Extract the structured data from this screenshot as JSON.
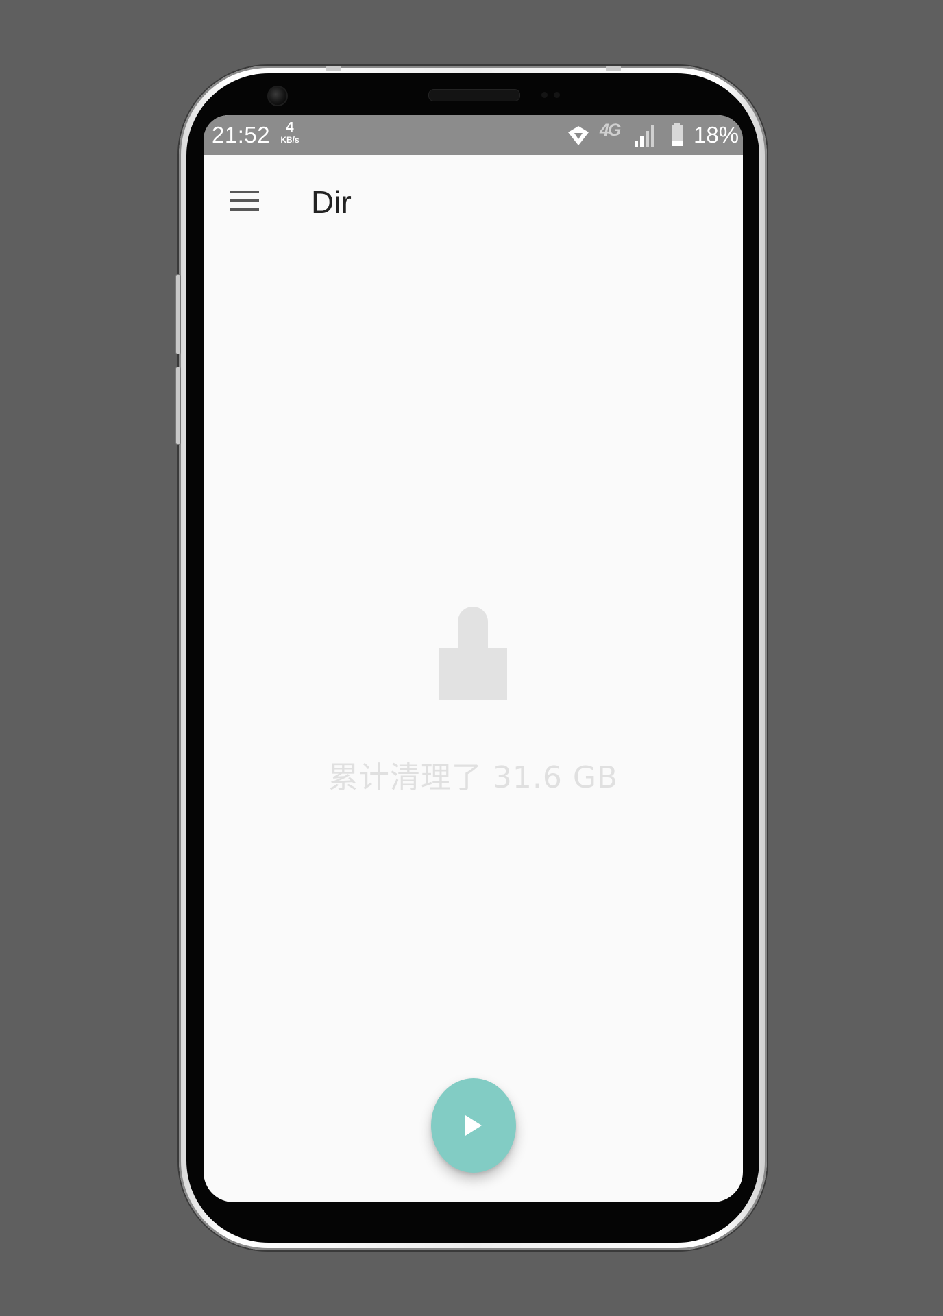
{
  "status_bar": {
    "time": "21:52",
    "net_speed_value": "4",
    "net_speed_unit": "KB/s",
    "network_type": "4G",
    "battery_percent": "18%",
    "icons": [
      "vpn-key-icon",
      "lte-icon",
      "signal-icon",
      "battery-icon"
    ]
  },
  "app_bar": {
    "title": "Dir",
    "menu_icon": "hamburger-menu-icon"
  },
  "empty_state": {
    "icon": "broom-icon",
    "message": "累计清理了 31.6 GB"
  },
  "fab": {
    "icon": "play-icon",
    "color": "#82ccc4"
  },
  "colors": {
    "background": "#5f5f5f",
    "status_bar": "#8c8c8c",
    "screen": "#fafafa",
    "accent": "#82ccc4"
  }
}
